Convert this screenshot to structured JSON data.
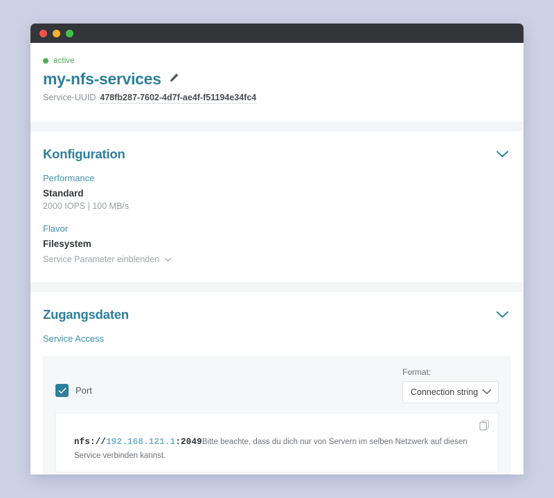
{
  "window": {
    "traffic_lights": [
      "close",
      "minimize",
      "maximize"
    ]
  },
  "header": {
    "status": "active",
    "status_color": "#4caf50",
    "title": "my-nfs-services",
    "edit_icon": "pencil-icon",
    "uuid_label": "Service-UUID",
    "uuid_value": "478fb287-7602-4d7f-ae4f-f51194e34fc4"
  },
  "konfiguration": {
    "title": "Konfiguration",
    "collapse_icon": "chevron-down-icon",
    "performance": {
      "label": "Performance",
      "value": "Standard",
      "detail": "2000 IOPS | 100 MB/s"
    },
    "flavor": {
      "label": "Flavor",
      "value": "Filesystem"
    },
    "params_toggle": "Service Parameter einblenden"
  },
  "zugangsdaten": {
    "title": "Zugangsdaten",
    "collapse_icon": "chevron-down-icon",
    "service_access_label": "Service Access",
    "port_checkbox": {
      "label": "Port",
      "checked": true
    },
    "format": {
      "label": "Format:",
      "selected": "Connection string"
    },
    "connection": {
      "scheme": "nfs://",
      "host": "192.168.121.1",
      "port": ":2049",
      "note": "Bitte beachte, dass du dich nur von Servern im selben Netzwerk auf diesen Service verbinden kannst.",
      "copy_icon": "copy-icon"
    }
  },
  "colors": {
    "accent": "#2d7f9c",
    "link": "#3f8fad",
    "page_bg": "#ccd2e6",
    "titlebar": "#333538",
    "status_green": "#4caf50",
    "host_blue": "#74b3cb"
  }
}
